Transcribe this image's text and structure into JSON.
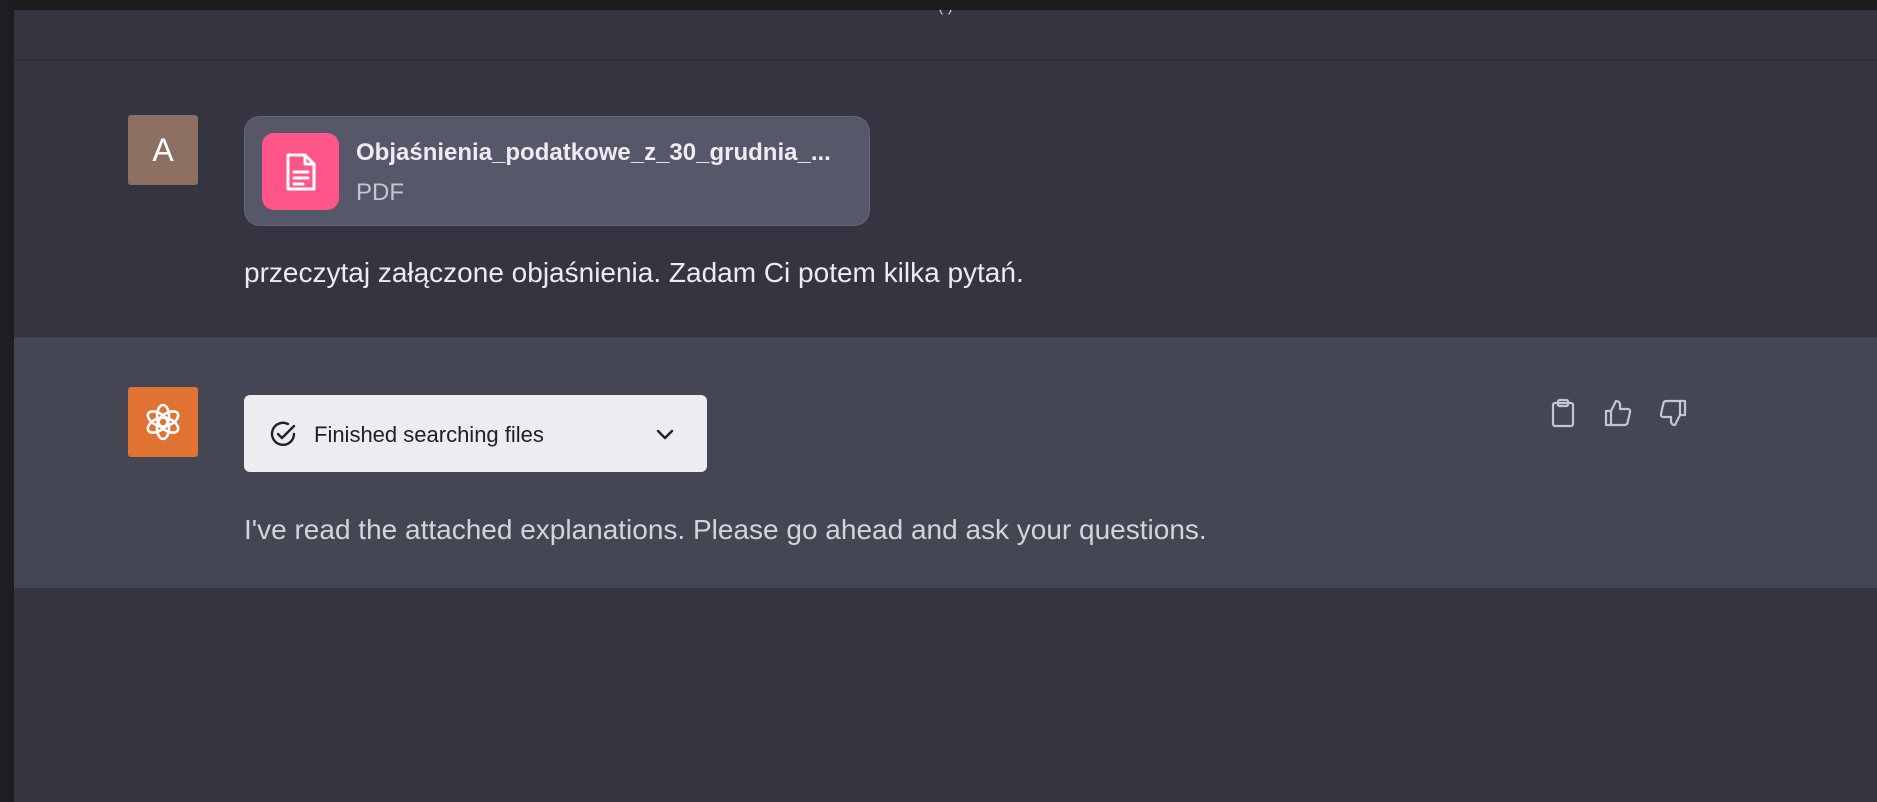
{
  "header": {
    "title": "(        )"
  },
  "messages": {
    "user": {
      "avatar_letter": "A",
      "attachment": {
        "name": "Objaśnienia_podatkowe_z_30_grudnia_...",
        "type": "PDF"
      },
      "text": "przeczytaj załączone objaśnienia. Zadam Ci potem kilka pytań."
    },
    "assistant": {
      "tool_status": "Finished searching files",
      "text": "I've read the attached explanations. Please go ahead and ask your questions."
    }
  },
  "actions": {
    "icons": [
      "clipboard-icon",
      "thumbs-up-icon",
      "thumbs-down-icon"
    ]
  },
  "colors": {
    "background": "#343541",
    "assistant_row": "#444654",
    "file_icon_bg": "#ff5588",
    "bot_avatar_bg": "#e07232",
    "user_avatar_bg": "#8c6f60"
  }
}
